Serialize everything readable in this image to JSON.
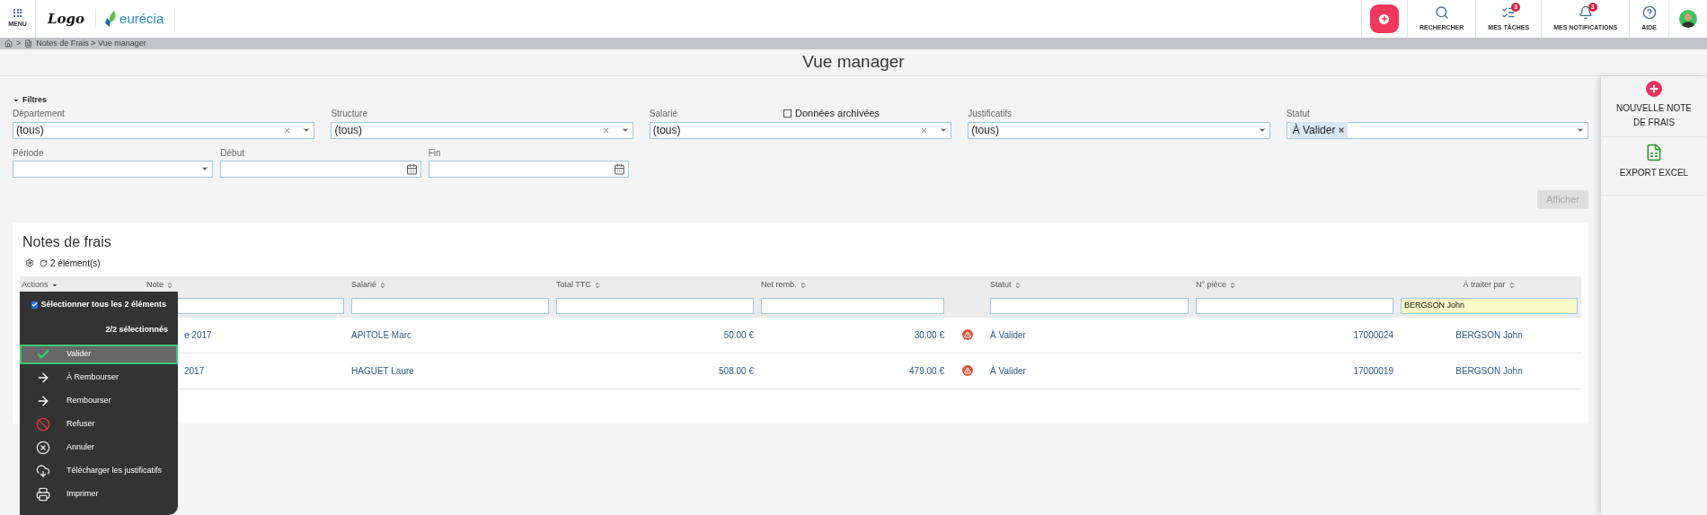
{
  "header": {
    "menu_label": "MENU",
    "logo_text": "Logo",
    "brand": "eurécia",
    "nav": [
      {
        "kind": "search",
        "label": "RECHERCHER"
      },
      {
        "kind": "tasks",
        "label": "MES TÂCHES",
        "badge": "3"
      },
      {
        "kind": "bell",
        "label": "MES NOTIFICATIONS",
        "badge": "3"
      },
      {
        "kind": "help",
        "label": "AIDE"
      }
    ]
  },
  "breadcrumb": {
    "separator": ">",
    "path": "Notes de Frais > Vue manager"
  },
  "page_title": "Vue manager",
  "filters": {
    "toggle": "Filtres",
    "expanded": true,
    "row1": [
      {
        "label": "Département",
        "value": "(tous)",
        "clearable": true
      },
      {
        "label": "Structure",
        "value": "(tous)",
        "clearable": true
      },
      {
        "label": "Salarié",
        "value": "(tous)",
        "clearable": true,
        "checkbox": {
          "label": "Données archivées",
          "checked": false
        }
      },
      {
        "label": "Justificatifs",
        "value": "(tous)",
        "clearable": false
      },
      {
        "label": "Statut",
        "tag": "À Valider",
        "clearable": false
      }
    ],
    "row2": [
      {
        "label": "Période",
        "kind": "select"
      },
      {
        "label": "Début",
        "kind": "date"
      },
      {
        "label": "Fin",
        "kind": "date"
      }
    ],
    "apply_button": {
      "label": "Afficher",
      "disabled": true
    }
  },
  "side_actions": [
    {
      "kind": "plus",
      "label": "NOUVELLE NOTE DE FRAIS"
    },
    {
      "kind": "excel",
      "label": "EXPORT EXCEL"
    }
  ],
  "table": {
    "title": "Notes de frais",
    "count": "2 élément(s)",
    "columns": [
      "Actions",
      "Note",
      "Salarié",
      "Total TTC",
      "Net remb.",
      "Statut",
      "N° pièce",
      "À traiter par"
    ],
    "column_filters": {
      "handler": "BERGSON John"
    },
    "rows": [
      {
        "note": "e 2017",
        "employee": "APITOLE Marc",
        "total": "50.00 €",
        "net": "30.00 €",
        "warning": true,
        "status": "À Valider",
        "piece": "17000024",
        "handler": "BERGSON John"
      },
      {
        "note": "2017",
        "employee": "HAGUET Laure",
        "total": "508.00 €",
        "net": "479.00 €",
        "warning": true,
        "status": "À Valider",
        "piece": "17000019",
        "handler": "BERGSON John"
      }
    ]
  },
  "actions_menu": {
    "select_all": {
      "label": "Sélectionner tous les 2 éléments",
      "checked": true
    },
    "selection_count": "2/2 sélectionnés",
    "items": [
      {
        "kind": "check",
        "label": "Valider",
        "selected": true
      },
      {
        "kind": "arrow",
        "label": "À Rembourser",
        "selected": false
      },
      {
        "kind": "arrow",
        "label": "Rembourser",
        "selected": false
      },
      {
        "kind": "forbid",
        "label": "Refuser",
        "selected": false
      },
      {
        "kind": "cancel",
        "label": "Annuler",
        "selected": false
      },
      {
        "kind": "download",
        "label": "Télécharger les justificatifs",
        "selected": false
      },
      {
        "kind": "print",
        "label": "Imprimer",
        "selected": false
      }
    ]
  }
}
